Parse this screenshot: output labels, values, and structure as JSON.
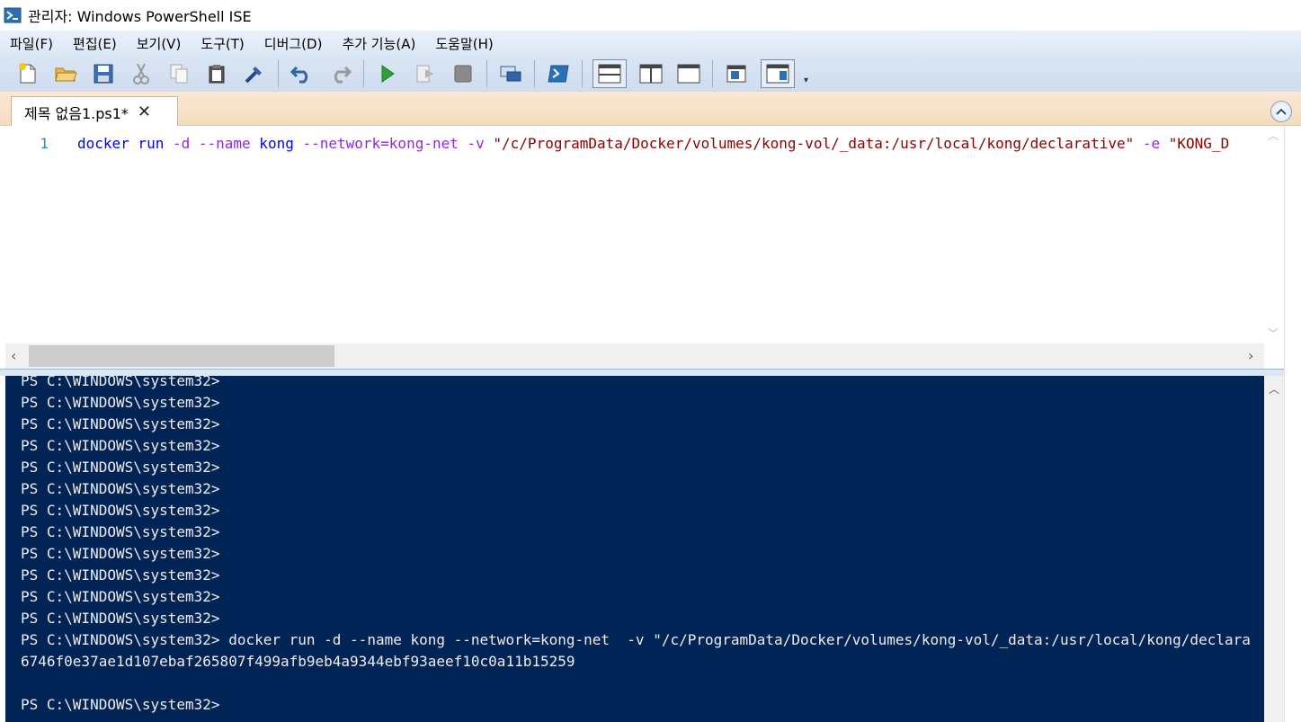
{
  "window": {
    "title": "관리자: Windows PowerShell ISE"
  },
  "menu": {
    "items": [
      {
        "label": "파일(F)"
      },
      {
        "label": "편집(E)"
      },
      {
        "label": "보기(V)"
      },
      {
        "label": "도구(T)"
      },
      {
        "label": "디버그(D)"
      },
      {
        "label": "추가 기능(A)"
      },
      {
        "label": "도움말(H)"
      }
    ]
  },
  "toolbar": {
    "icons": [
      "new-file-icon",
      "open-folder-icon",
      "save-icon",
      "cut-icon",
      "copy-icon",
      "paste-icon",
      "clear-console-icon",
      "undo-icon",
      "redo-icon",
      "run-script-icon",
      "run-selection-icon",
      "stop-icon",
      "new-remote-tab-icon",
      "powershell-icon",
      "show-script-top-icon",
      "show-script-right-icon",
      "show-script-maximized-icon",
      "show-command-window-icon",
      "show-command-addon-icon",
      "toolbar-overflow-icon"
    ]
  },
  "tabs": [
    {
      "label": "제목 없음1.ps1*",
      "close": "✕"
    }
  ],
  "editor": {
    "line_number": "1",
    "tokens": [
      {
        "text": "docker",
        "kind": "cmd"
      },
      {
        "text": " run ",
        "kind": "cmd"
      },
      {
        "text": "-d",
        "kind": "arg"
      },
      {
        "text": " ",
        "kind": "plain"
      },
      {
        "text": "--name",
        "kind": "arg"
      },
      {
        "text": " kong ",
        "kind": "cmd"
      },
      {
        "text": "--network=kong-net",
        "kind": "arg"
      },
      {
        "text": "  ",
        "kind": "plain"
      },
      {
        "text": "-v",
        "kind": "arg"
      },
      {
        "text": " \"/c/ProgramData/Docker/volumes/kong-vol/_data:/usr/local/kong/declarative\"",
        "kind": "str"
      },
      {
        "text": "  ",
        "kind": "plain"
      },
      {
        "text": "-e",
        "kind": "arg"
      },
      {
        "text": " \"KONG_D",
        "kind": "str"
      }
    ]
  },
  "console": {
    "lines": [
      "PS C:\\WINDOWS\\system32>",
      "PS C:\\WINDOWS\\system32>",
      "PS C:\\WINDOWS\\system32>",
      "PS C:\\WINDOWS\\system32>",
      "PS C:\\WINDOWS\\system32>",
      "PS C:\\WINDOWS\\system32>",
      "PS C:\\WINDOWS\\system32>",
      "PS C:\\WINDOWS\\system32>",
      "PS C:\\WINDOWS\\system32>",
      "PS C:\\WINDOWS\\system32>",
      "PS C:\\WINDOWS\\system32>",
      "PS C:\\WINDOWS\\system32>",
      "PS C:\\WINDOWS\\system32> docker run -d --name kong --network=kong-net  -v \"/c/ProgramData/Docker/volumes/kong-vol/_data:/usr/local/kong/declara",
      "6746f0e37ae1d107ebaf265807f499afb9eb4a9344ebf93aeef10c0a11b15259",
      "",
      "PS C:\\WINDOWS\\system32>"
    ]
  },
  "colors": {
    "console_bg": "#012456",
    "console_fg": "#eeedf0",
    "tab_strip_bg": "#f5dcc0",
    "toolbar_bg": "#dbe6f4"
  }
}
